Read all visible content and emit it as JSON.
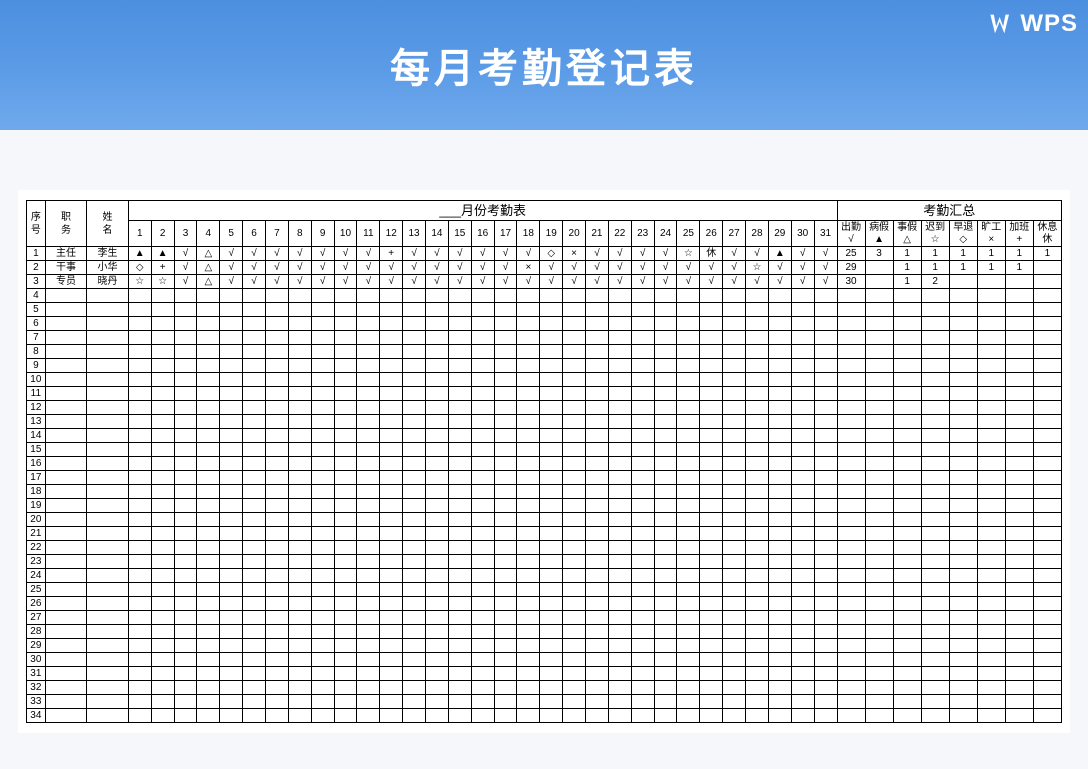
{
  "banner": {
    "title": "每月考勤登记表",
    "logo_text": "WPS"
  },
  "headers": {
    "seq": "序号",
    "role": "职务",
    "name": "姓名",
    "month_title": "___月份考勤表",
    "summary_title": "考勤汇总",
    "days": [
      "1",
      "2",
      "3",
      "4",
      "5",
      "6",
      "7",
      "8",
      "9",
      "10",
      "11",
      "12",
      "13",
      "14",
      "15",
      "16",
      "17",
      "18",
      "19",
      "20",
      "21",
      "22",
      "23",
      "24",
      "25",
      "26",
      "27",
      "28",
      "29",
      "30",
      "31"
    ],
    "summary_cols": [
      {
        "label": "出勤",
        "sym": "√"
      },
      {
        "label": "病假",
        "sym": "▲"
      },
      {
        "label": "事假",
        "sym": "△"
      },
      {
        "label": "迟到",
        "sym": "☆"
      },
      {
        "label": "早退",
        "sym": "◇"
      },
      {
        "label": "旷工",
        "sym": "×"
      },
      {
        "label": "加班",
        "sym": "+"
      },
      {
        "label": "休息",
        "sym": "休"
      }
    ]
  },
  "rows": [
    {
      "seq": "1",
      "role": "主任",
      "name": "李生",
      "days": [
        "▲",
        "▲",
        "√",
        "△",
        "√",
        "√",
        "√",
        "√",
        "√",
        "√",
        "√",
        "+",
        "√",
        "√",
        "√",
        "√",
        "√",
        "√",
        "◇",
        "×",
        "√",
        "√",
        "√",
        "√",
        "☆",
        "休",
        "√",
        "√",
        "▲",
        "√",
        "√"
      ],
      "summary": [
        "25",
        "3",
        "1",
        "1",
        "1",
        "1",
        "1",
        "1"
      ]
    },
    {
      "seq": "2",
      "role": "干事",
      "name": "小华",
      "days": [
        "◇",
        "+",
        "√",
        "△",
        "√",
        "√",
        "√",
        "√",
        "√",
        "√",
        "√",
        "√",
        "√",
        "√",
        "√",
        "√",
        "√",
        "×",
        "√",
        "√",
        "√",
        "√",
        "√",
        "√",
        "√",
        "√",
        "√",
        "☆",
        "√",
        "√",
        "√"
      ],
      "summary": [
        "29",
        "",
        "1",
        "1",
        "1",
        "1",
        "1",
        ""
      ]
    },
    {
      "seq": "3",
      "role": "专员",
      "name": "晓丹",
      "days": [
        "☆",
        "☆",
        "√",
        "△",
        "√",
        "√",
        "√",
        "√",
        "√",
        "√",
        "√",
        "√",
        "√",
        "√",
        "√",
        "√",
        "√",
        "√",
        "√",
        "√",
        "√",
        "√",
        "√",
        "√",
        "√",
        "√",
        "√",
        "√",
        "√",
        "√",
        "√"
      ],
      "summary": [
        "30",
        "",
        "1",
        "2",
        "",
        "",
        "",
        ""
      ]
    }
  ],
  "empty_seq": [
    "4",
    "5",
    "6",
    "7",
    "8",
    "9",
    "10",
    "11",
    "12",
    "13",
    "14",
    "15",
    "16",
    "17",
    "18",
    "19",
    "20",
    "21",
    "22",
    "23",
    "24",
    "25",
    "26",
    "27",
    "28",
    "29",
    "30",
    "31",
    "32",
    "33",
    "34"
  ]
}
